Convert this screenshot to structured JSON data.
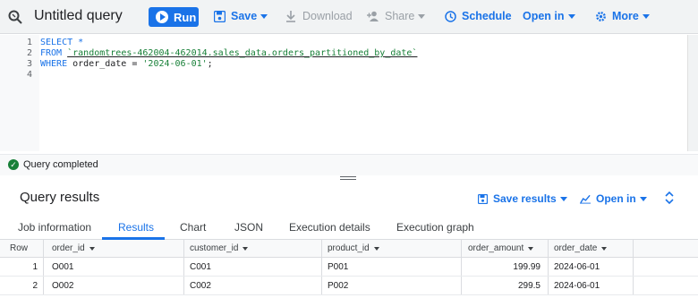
{
  "toolbar": {
    "title": "Untitled query",
    "run": "Run",
    "save": "Save",
    "download": "Download",
    "share": "Share",
    "schedule": "Schedule",
    "open_in": "Open in",
    "more": "More",
    "icons": {
      "query": "query-search-icon",
      "run": "play-circle-icon",
      "save": "save-icon",
      "download": "download-icon",
      "share": "person-add-icon",
      "schedule": "clock-icon"
    }
  },
  "editor": {
    "line_numbers": [
      "1",
      "2",
      "3",
      "4"
    ],
    "lines": [
      [
        {
          "t": "SELECT *",
          "c": "kw"
        }
      ],
      [
        {
          "t": "FROM ",
          "c": "kw"
        },
        {
          "t": "`randomtrees-462004-462014.sales_data.orders_partitioned_by_date`",
          "c": "tbl"
        }
      ],
      [
        {
          "t": "WHERE ",
          "c": "kw"
        },
        {
          "t": "order_date = ",
          "c": ""
        },
        {
          "t": "'2024-06-01'",
          "c": "str"
        },
        {
          "t": ";",
          "c": ""
        }
      ],
      []
    ]
  },
  "status": {
    "text": "Query completed",
    "icon": "check-circle-icon",
    "color": "#188038"
  },
  "results": {
    "title": "Query results",
    "save_results": "Save results",
    "open_in": "Open in",
    "tabs": [
      "Job information",
      "Results",
      "Chart",
      "JSON",
      "Execution details",
      "Execution graph"
    ],
    "active_tab": "Results",
    "columns": [
      "Row",
      "order_id",
      "customer_id",
      "product_id",
      "order_amount",
      "order_date"
    ],
    "rows": [
      [
        "1",
        "O001",
        "C001",
        "P001",
        "199.99",
        "2024-06-01"
      ],
      [
        "2",
        "O002",
        "C002",
        "P002",
        "299.5",
        "2024-06-01"
      ]
    ]
  },
  "colors": {
    "accent": "#1a73e8",
    "string": "#188038",
    "disabled": "#9aa0a6"
  }
}
